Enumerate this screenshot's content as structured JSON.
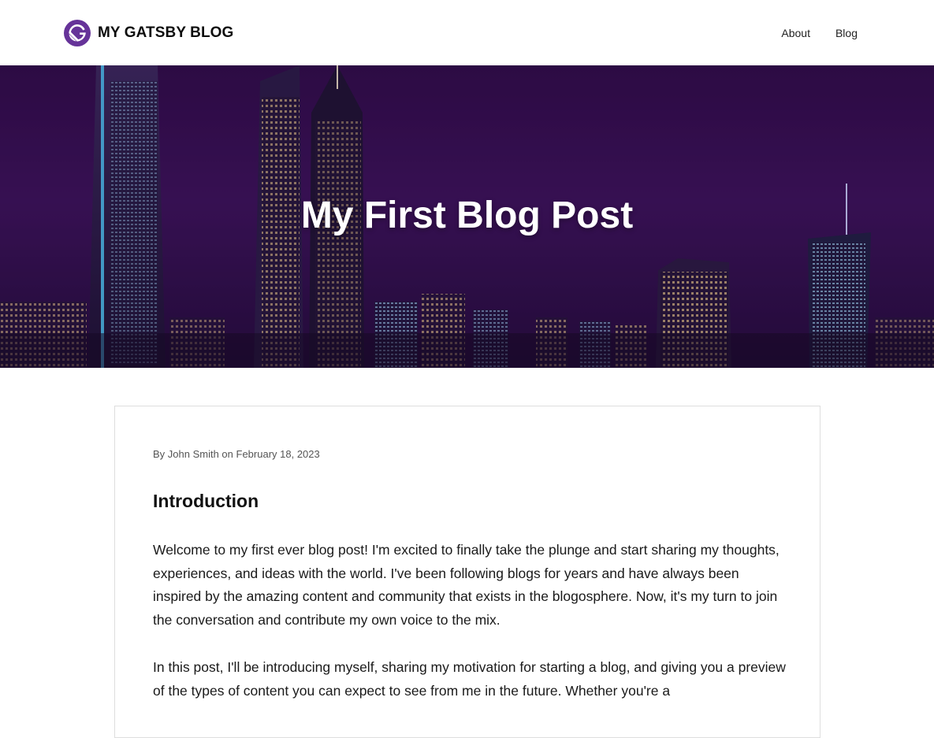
{
  "header": {
    "brand": "MY GATSBY BLOG",
    "logo_icon": "gatsby-logo-icon",
    "nav": [
      {
        "label": "About"
      },
      {
        "label": "Blog"
      }
    ]
  },
  "hero": {
    "title": "My First Blog Post",
    "image": "city-skyline-night-image"
  },
  "post": {
    "byline": "By John Smith on February 18, 2023",
    "section_title": "Introduction",
    "paragraphs": [
      "Welcome to my first ever blog post! I'm excited to finally take the plunge and start sharing my thoughts, experiences, and ideas with the world. I've been following blogs for years and have always been inspired by the amazing content and community that exists in the blogosphere. Now, it's my turn to join the conversation and contribute my own voice to the mix.",
      "In this post, I'll be introducing myself, sharing my motivation for starting a blog, and giving you a preview of the types of content you can expect to see from me in the future. Whether you're a"
    ]
  },
  "colors": {
    "brand_purple": "#663399",
    "hero_overlay": "#2a0a45",
    "card_border": "#dedede"
  }
}
